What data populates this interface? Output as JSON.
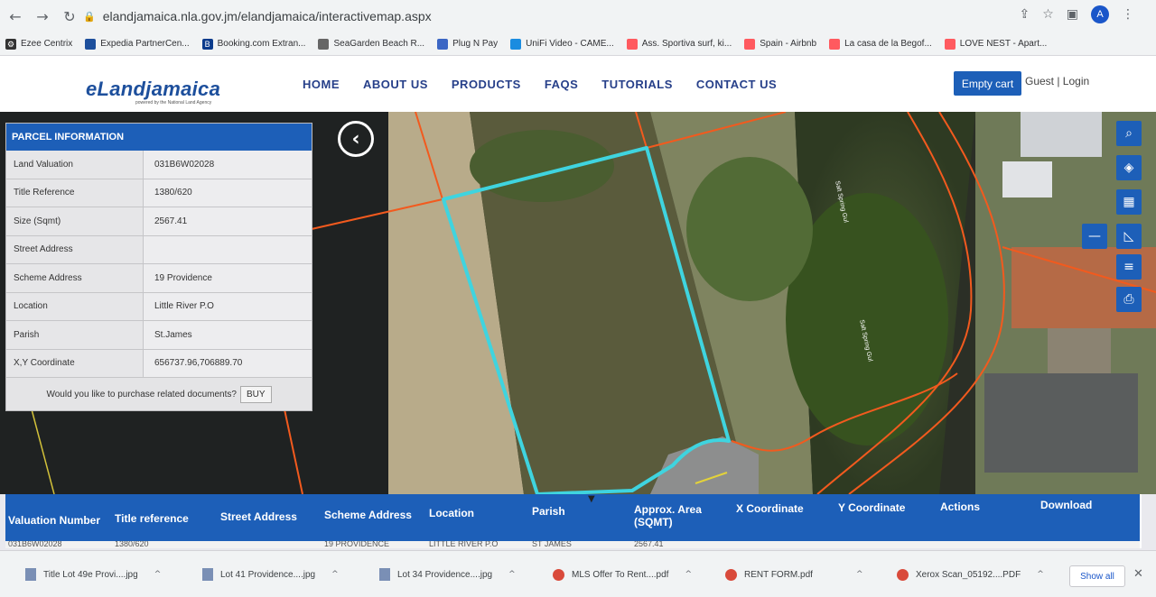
{
  "browser": {
    "url": "elandjamaica.nla.gov.jm/elandjamaica/interactivemap.aspx",
    "avatar_letter": "A",
    "bookmarks": [
      {
        "label": "Ezee Centrix"
      },
      {
        "label": "Expedia PartnerCen..."
      },
      {
        "label": "Booking.com Extran..."
      },
      {
        "label": "SeaGarden Beach R..."
      },
      {
        "label": "Plug N Pay"
      },
      {
        "label": "UniFi Video - CAME..."
      },
      {
        "label": "Ass. Sportiva surf, ki..."
      },
      {
        "label": "Spain - Airbnb"
      },
      {
        "label": "La casa de la Begof..."
      },
      {
        "label": "LOVE NEST - Apart..."
      }
    ]
  },
  "site": {
    "logo": "eLandjamaica",
    "logo_sub": "powered by the National Land Agency",
    "nav": [
      "HOME",
      "ABOUT US",
      "PRODUCTS",
      "FAQS",
      "TUTORIALS",
      "CONTACT US"
    ],
    "cart_label": "Empty cart",
    "guest_label": "Guest | Login"
  },
  "parcel": {
    "title": "PARCEL INFORMATION",
    "rows": [
      {
        "key": "Land Valuation",
        "value": "031B6W02028"
      },
      {
        "key": "Title Reference",
        "value": "1380/620"
      },
      {
        "key": "Size (Sqmt)",
        "value": "2567.41"
      },
      {
        "key": "Street Address",
        "value": ""
      },
      {
        "key": "Scheme Address",
        "value": "19 Providence"
      },
      {
        "key": "Location",
        "value": "Little River P.O"
      },
      {
        "key": "Parish",
        "value": "St.James"
      },
      {
        "key": "X,Y Coordinate",
        "value": "656737.96,706889.70"
      }
    ],
    "purchase_prompt": "Would you like to purchase related documents?",
    "buy_label": "BUY"
  },
  "map": {
    "street_label": "Salt Spring Gul",
    "colors": {
      "parcel_outline": "#3fd4df",
      "boundary_lines": "#f25a1e"
    }
  },
  "results": {
    "columns": [
      "Valuation Number",
      "Title reference",
      "Street Address",
      "Scheme Address",
      "Location",
      "Parish",
      "Approx. Area (SQMT)",
      "X Coordinate",
      "Y Coordinate",
      "Actions",
      "Download"
    ],
    "row_partial": [
      "031B6W02028",
      "1380/620",
      "",
      "19 PROVIDENCE",
      "LITTLE RIVER P.O",
      "ST JAMES",
      "2567.41"
    ]
  },
  "downloads": {
    "items": [
      {
        "label": "Title Lot 49e Provi....jpg",
        "type": "jpg"
      },
      {
        "label": "Lot 41 Providence....jpg",
        "type": "jpg"
      },
      {
        "label": "Lot 34 Providence....jpg",
        "type": "jpg"
      },
      {
        "label": "MLS Offer To Rent....pdf",
        "type": "pdf"
      },
      {
        "label": "RENT FORM.pdf",
        "type": "pdf"
      },
      {
        "label": "Xerox Scan_05192....PDF",
        "type": "pdf"
      }
    ],
    "show_all": "Show all"
  }
}
